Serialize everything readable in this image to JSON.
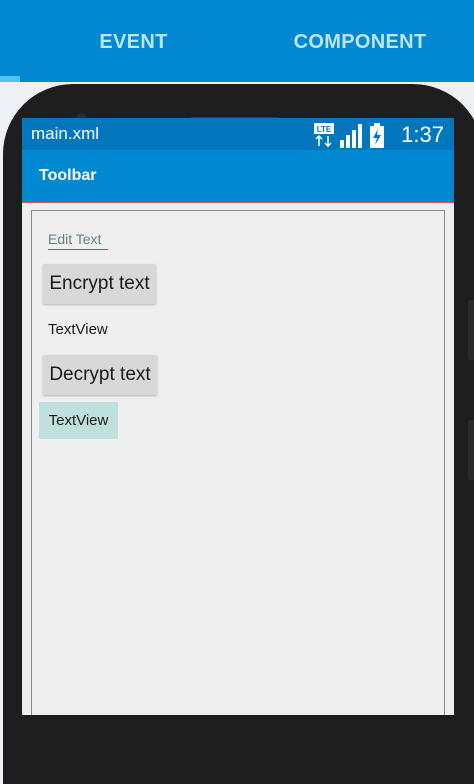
{
  "tabs": [
    {
      "label": "EVENT"
    },
    {
      "label": "COMPONENT"
    }
  ],
  "device": {
    "status_bar": {
      "title": "main.xml",
      "network_label": "LTE",
      "time": "1:37"
    },
    "toolbar": {
      "title": "Toolbar"
    },
    "layout": {
      "edit_text_hint": "Edit Text",
      "encrypt_button": "Encrypt text",
      "text_view_1": "TextView",
      "decrypt_button": "Decrypt text",
      "text_view_2": "TextView"
    }
  },
  "colors": {
    "app_bar": "#0288d1",
    "status_bar": "#0277bd",
    "selected_view": "#bfe0dc"
  },
  "icons": [
    "lte-icon",
    "signal-icon",
    "battery-charging-icon"
  ]
}
